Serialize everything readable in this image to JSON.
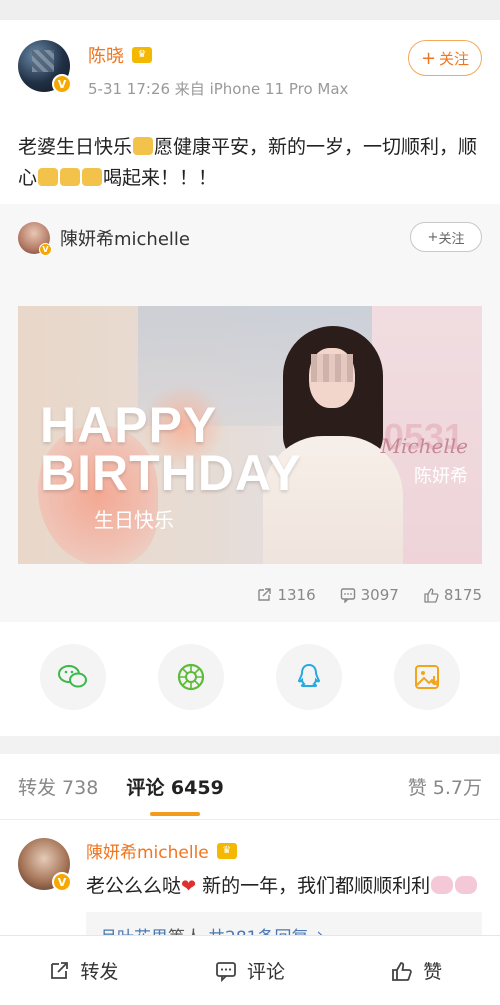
{
  "post": {
    "author": "陈晓",
    "time_source": "5-31 17:26  来自 iPhone 11 Pro Max",
    "follow_label": "关注",
    "text_1": "老婆生日快乐",
    "text_2": "愿健康平安，新的一岁，一切顺利，顺心",
    "text_3": "喝起来！！！"
  },
  "repost": {
    "author": "陳妍希michelle",
    "follow_label": "关注",
    "banner": {
      "happy": "HAPPY",
      "birthday": "BIRTHDAY",
      "cn_birthday": "生日快乐",
      "date": "0531",
      "signature": "Michelle",
      "cn_name": "陈妍希"
    },
    "stats": {
      "reposts": "1316",
      "comments": "3097",
      "likes": "8175"
    }
  },
  "share": [
    "wechat-icon",
    "moments-icon",
    "qq-icon",
    "save-image-icon"
  ],
  "tabs": {
    "repost": "转发 738",
    "comment": "评论 6459",
    "like": "赞 5.7万"
  },
  "comment": {
    "author": "陳妍希michelle",
    "text_1": "老公么么哒",
    "text_2": " 新的一年，我们都顺顺利利",
    "replies_users": "月叶花果",
    "replies_mid": "等人",
    "replies_count": "共281条回复",
    "replies_arrow": "›"
  },
  "bottom": {
    "repost": "转发",
    "comment": "评论",
    "like": "赞"
  },
  "colors": {
    "accent_orange": "#f0751f",
    "tab_underline": "#f29b1c",
    "link_blue": "#4a79b3"
  }
}
